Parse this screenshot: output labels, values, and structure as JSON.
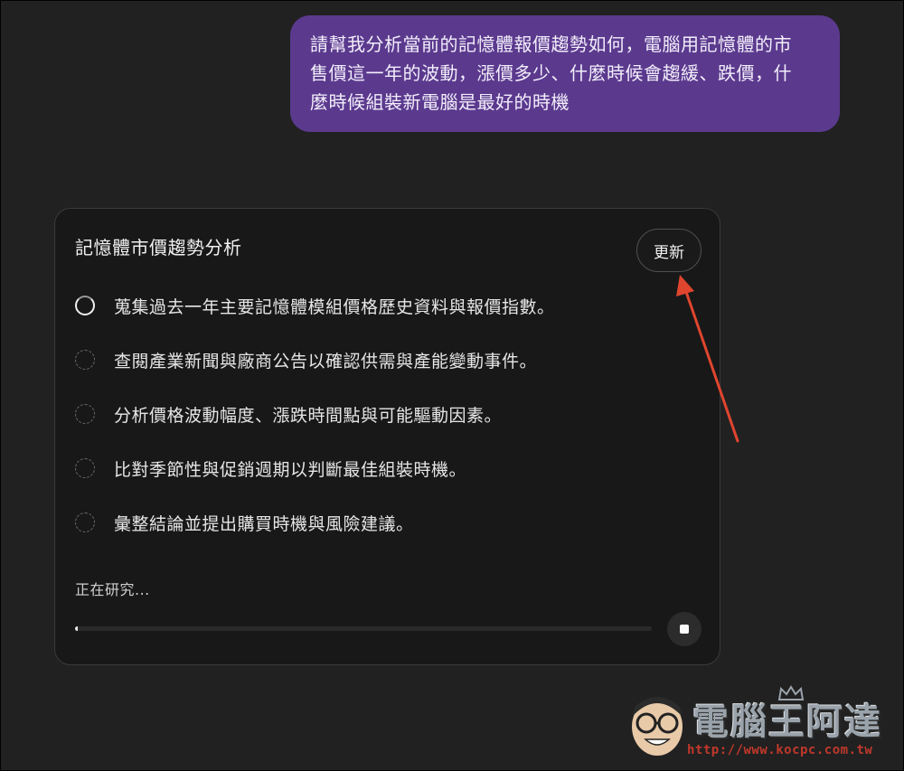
{
  "user_message": {
    "lines": [
      "請幫我分析當前的記憶體報價趨勢如何，電腦用記憶體的市",
      "售價這一年的波動，漲價多少、什麼時候會趨緩、跌價，什",
      "麼時候組裝新電腦是最好的時機"
    ]
  },
  "research_card": {
    "title": "記憶體市價趨勢分析",
    "update_label": "更新",
    "steps": [
      {
        "text": "蒐集過去一年主要記憶體模組價格歷史資料與報價指數。",
        "state": "in-progress"
      },
      {
        "text": "查閱產業新聞與廠商公告以確認供需與產能變動事件。",
        "state": "pending"
      },
      {
        "text": "分析價格波動幅度、漲跌時間點與可能驅動因素。",
        "state": "pending"
      },
      {
        "text": "比對季節性與促銷週期以判斷最佳組裝時機。",
        "state": "pending"
      },
      {
        "text": "彙整結論並提出購買時機與風險建議。",
        "state": "pending"
      }
    ],
    "status_text": "正在研究...",
    "progress_percent": 0.4
  },
  "watermark": {
    "title": "電腦王阿達",
    "url": "http://www.kocpc.com.tw"
  },
  "colors": {
    "background": "#212121",
    "user_bubble": "#5b3a8e",
    "card": "#181818",
    "arrow": "#e0452f"
  }
}
